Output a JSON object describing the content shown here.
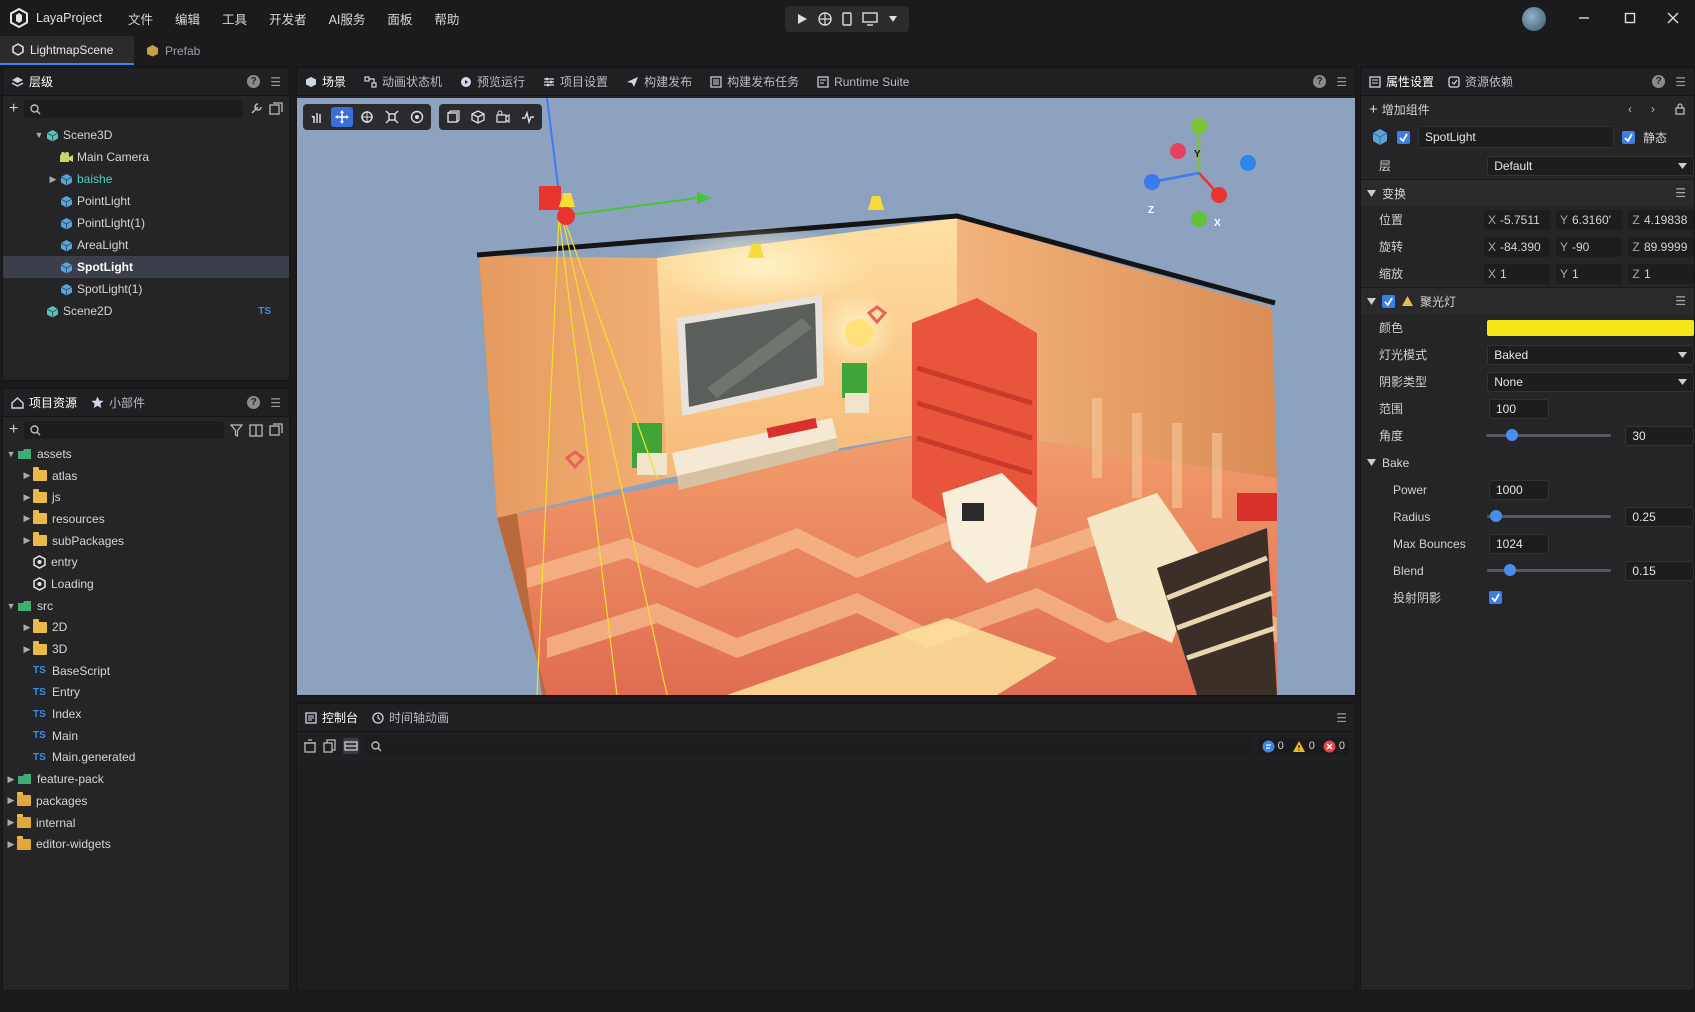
{
  "app": {
    "name": "LayaProject",
    "menu": [
      "文件",
      "编辑",
      "工具",
      "开发者",
      "AI服务",
      "面板",
      "帮助"
    ]
  },
  "doc_tabs": [
    {
      "label": "LightmapScene",
      "active": true
    },
    {
      "label": "Prefab",
      "active": false
    }
  ],
  "hierarchy": {
    "tab": "层级",
    "items": [
      {
        "label": "Scene3D",
        "depth": 0,
        "arrow": "down",
        "icon": "scene3d-icon"
      },
      {
        "label": "Main Camera",
        "depth": 1,
        "arrow": "",
        "icon": "camera-icon"
      },
      {
        "label": "baishe",
        "depth": 1,
        "arrow": "right",
        "icon": "cube-icon",
        "color": "#4fd1c5"
      },
      {
        "label": "PointLight",
        "depth": 1,
        "arrow": "",
        "icon": "cube-icon"
      },
      {
        "label": "PointLight(1)",
        "depth": 1,
        "arrow": "",
        "icon": "cube-icon"
      },
      {
        "label": "AreaLight",
        "depth": 1,
        "arrow": "",
        "icon": "cube-icon"
      },
      {
        "label": "SpotLight",
        "depth": 1,
        "arrow": "",
        "icon": "cube-icon",
        "selected": true
      },
      {
        "label": "SpotLight(1)",
        "depth": 1,
        "arrow": "",
        "icon": "cube-icon"
      },
      {
        "label": "Scene2D",
        "depth": 0,
        "arrow": "",
        "icon": "scene2d-icon",
        "badge": "TS"
      }
    ]
  },
  "assets": {
    "tabs": [
      "项目资源",
      "小部件"
    ],
    "items": [
      {
        "label": "assets",
        "depth": 0,
        "arrow": "down",
        "type": "root"
      },
      {
        "label": "atlas",
        "depth": 1,
        "arrow": "right",
        "type": "folder"
      },
      {
        "label": "js",
        "depth": 1,
        "arrow": "right",
        "type": "folder"
      },
      {
        "label": "resources",
        "depth": 1,
        "arrow": "right",
        "type": "folder"
      },
      {
        "label": "subPackages",
        "depth": 1,
        "arrow": "right",
        "type": "folder"
      },
      {
        "label": "entry",
        "depth": 1,
        "arrow": "",
        "type": "scene"
      },
      {
        "label": "Loading",
        "depth": 1,
        "arrow": "",
        "type": "scene"
      },
      {
        "label": "src",
        "depth": 0,
        "arrow": "down",
        "type": "root"
      },
      {
        "label": "2D",
        "depth": 1,
        "arrow": "right",
        "type": "folder"
      },
      {
        "label": "3D",
        "depth": 1,
        "arrow": "right",
        "type": "folder"
      },
      {
        "label": "BaseScript",
        "depth": 1,
        "arrow": "",
        "type": "ts"
      },
      {
        "label": "Entry",
        "depth": 1,
        "arrow": "",
        "type": "ts"
      },
      {
        "label": "Index",
        "depth": 1,
        "arrow": "",
        "type": "ts"
      },
      {
        "label": "Main",
        "depth": 1,
        "arrow": "",
        "type": "ts"
      },
      {
        "label": "Main.generated",
        "depth": 1,
        "arrow": "",
        "type": "ts"
      },
      {
        "label": "feature-pack",
        "depth": 0,
        "arrow": "right",
        "type": "root"
      },
      {
        "label": "packages",
        "depth": 0,
        "arrow": "right",
        "type": "lockfolder"
      },
      {
        "label": "internal",
        "depth": 0,
        "arrow": "right",
        "type": "lockfolder"
      },
      {
        "label": "editor-widgets",
        "depth": 0,
        "arrow": "right",
        "type": "lockfolder"
      }
    ]
  },
  "center_tabs": [
    "场景",
    "动画状态机",
    "预览运行",
    "项目设置",
    "构建发布",
    "构建发布任务",
    "Runtime Suite"
  ],
  "gizmo_axes": {
    "x": "X",
    "y": "Y",
    "z": "Z"
  },
  "console": {
    "tabs": [
      "控制台",
      "时间轴动画"
    ],
    "info_count": "0",
    "warn_count": "0",
    "error_count": "0"
  },
  "inspector": {
    "tabs": [
      "属性设置",
      "资源依赖"
    ],
    "add_component": "增加组件",
    "node_name": "SpotLight",
    "static_label": "静态",
    "layer_label": "层",
    "layer_value": "Default",
    "transform_title": "变换",
    "position": {
      "label": "位置",
      "x": "-5.7511",
      "y": "6.3160'",
      "z": "4.19838"
    },
    "rotation": {
      "label": "旋转",
      "x": "-84.390",
      "y": "-90",
      "z": "89.9999"
    },
    "scale": {
      "label": "缩放",
      "x": "1",
      "y": "1",
      "z": "1"
    },
    "spot_title": "聚光灯",
    "color_label": "颜色",
    "color_value": "#f5e61a",
    "light_mode_label": "灯光模式",
    "light_mode_value": "Baked",
    "shadow_type_label": "阴影类型",
    "shadow_type_value": "None",
    "range_label": "范围",
    "range_value": "100",
    "angle_label": "角度",
    "angle_value": "30",
    "angle_fraction": 0.17,
    "bake_title": "Bake",
    "power_label": "Power",
    "power_value": "1000",
    "radius_label": "Radius",
    "radius_value": "0.25",
    "radius_fraction": 0.03,
    "max_bounces_label": "Max Bounces",
    "max_bounces_value": "1024",
    "blend_label": "Blend",
    "blend_value": "0.15",
    "blend_fraction": 0.15,
    "cast_shadow_label": "投射阴影"
  }
}
